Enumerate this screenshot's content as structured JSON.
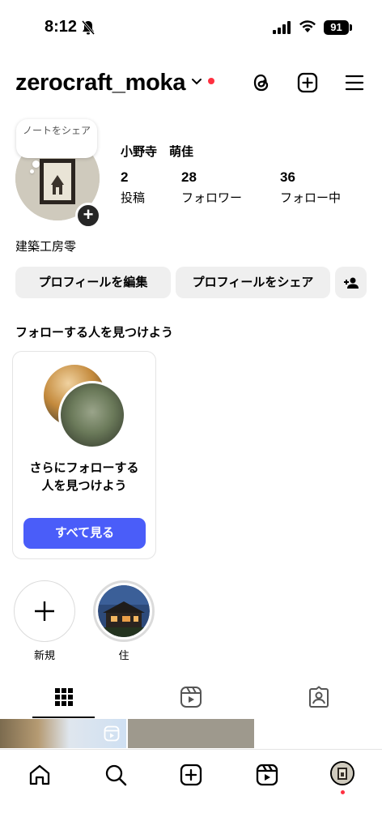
{
  "status_bar": {
    "time": "8:12",
    "battery": "91"
  },
  "header": {
    "username": "zerocraft_moka"
  },
  "profile": {
    "note": "ノートをシェア",
    "full_name": "小野寺　萌佳",
    "stats": [
      {
        "value": "2",
        "label": "投稿"
      },
      {
        "value": "28",
        "label": "フォロワー"
      },
      {
        "value": "36",
        "label": "フォロー中"
      }
    ],
    "bio": "建築工房零",
    "edit_button": "プロフィールを編集",
    "share_button": "プロフィールをシェア"
  },
  "suggestions": {
    "title": "フォローする人を見つけよう",
    "card_text_line1": "さらにフォローする",
    "card_text_line2": "人を見つけよう",
    "card_button": "すべて見る"
  },
  "highlights": [
    {
      "label": "新規"
    },
    {
      "label": "住"
    }
  ],
  "tabs": [
    {
      "icon": "grid-icon"
    },
    {
      "icon": "reels-icon"
    },
    {
      "icon": "tagged-icon"
    }
  ],
  "bottom_nav": [
    {
      "icon": "home-icon"
    },
    {
      "icon": "search-icon"
    },
    {
      "icon": "create-icon"
    },
    {
      "icon": "reels-icon"
    },
    {
      "icon": "profile-avatar"
    }
  ],
  "colors": {
    "accent": "#4a5df9",
    "notification": "#ff3040"
  }
}
